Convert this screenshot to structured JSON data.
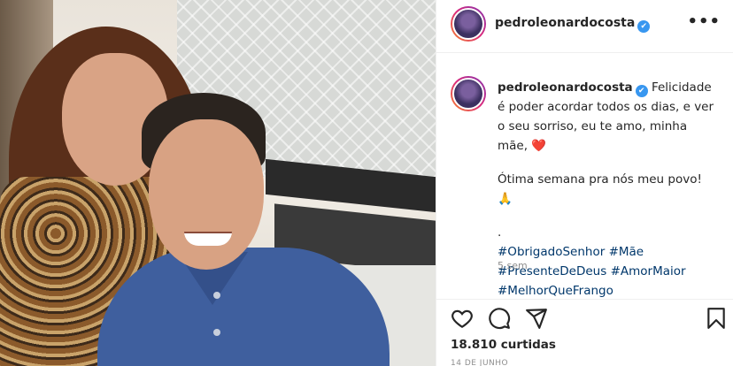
{
  "post": {
    "username": "pedroleonardocosta",
    "verified_glyph": "✔",
    "more_glyph": "•••",
    "caption": {
      "line1": "Felicidade é poder acordar todos os dias, e ver o seu sorriso, eu te amo, minha mãe,",
      "heart_emoji": "❤️",
      "line2": "Ótima semana pra nós meu povo!",
      "pray_emoji": "🙏",
      "dot": ".",
      "hashtags": [
        "#ObrigadoSenhor",
        "#Mãe",
        "#PresenteDeDeus",
        "#AmorMaior",
        "#MelhorQueFrango"
      ],
      "time_ago": "5 sem"
    },
    "likes": "18.810 curtidas",
    "date": "14 DE JUNHO"
  },
  "icons": {
    "like": "heart-icon",
    "comment": "comment-icon",
    "share": "share-icon",
    "save": "bookmark-icon"
  },
  "colors": {
    "hashtag": "#00376b",
    "verified": "#3897f0",
    "muted": "#8e8e8e"
  }
}
